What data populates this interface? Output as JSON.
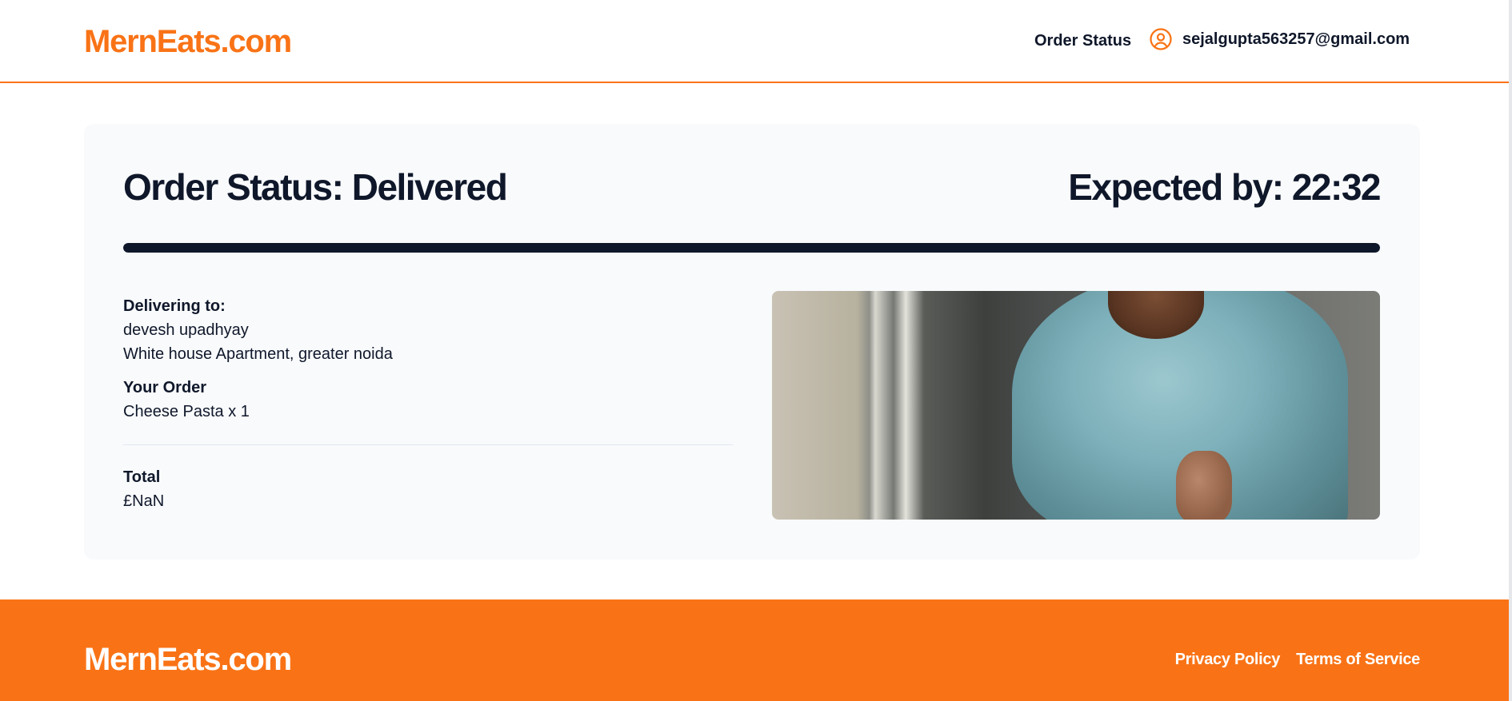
{
  "header": {
    "logo": "MernEats.com",
    "nav_order_status": "Order Status",
    "user_email": "sejalgupta563257@gmail.com"
  },
  "order": {
    "status_title": "Order Status: Delivered",
    "expected": "Expected by: 22:32",
    "progress_percent": 100,
    "delivering_to_label": "Delivering to:",
    "recipient_name": "devesh upadhyay",
    "address": "White house Apartment, greater noida",
    "your_order_label": "Your Order",
    "items": [
      "Cheese Pasta x 1"
    ],
    "total_label": "Total",
    "total_value": "£NaN"
  },
  "footer": {
    "logo": "MernEats.com",
    "privacy_policy": "Privacy Policy",
    "terms_of_service": "Terms of Service"
  },
  "icons": {
    "user": "user-circle-icon"
  },
  "colors": {
    "brand": "#f97316",
    "text": "#0f172a",
    "card_bg": "#f8fafc"
  }
}
